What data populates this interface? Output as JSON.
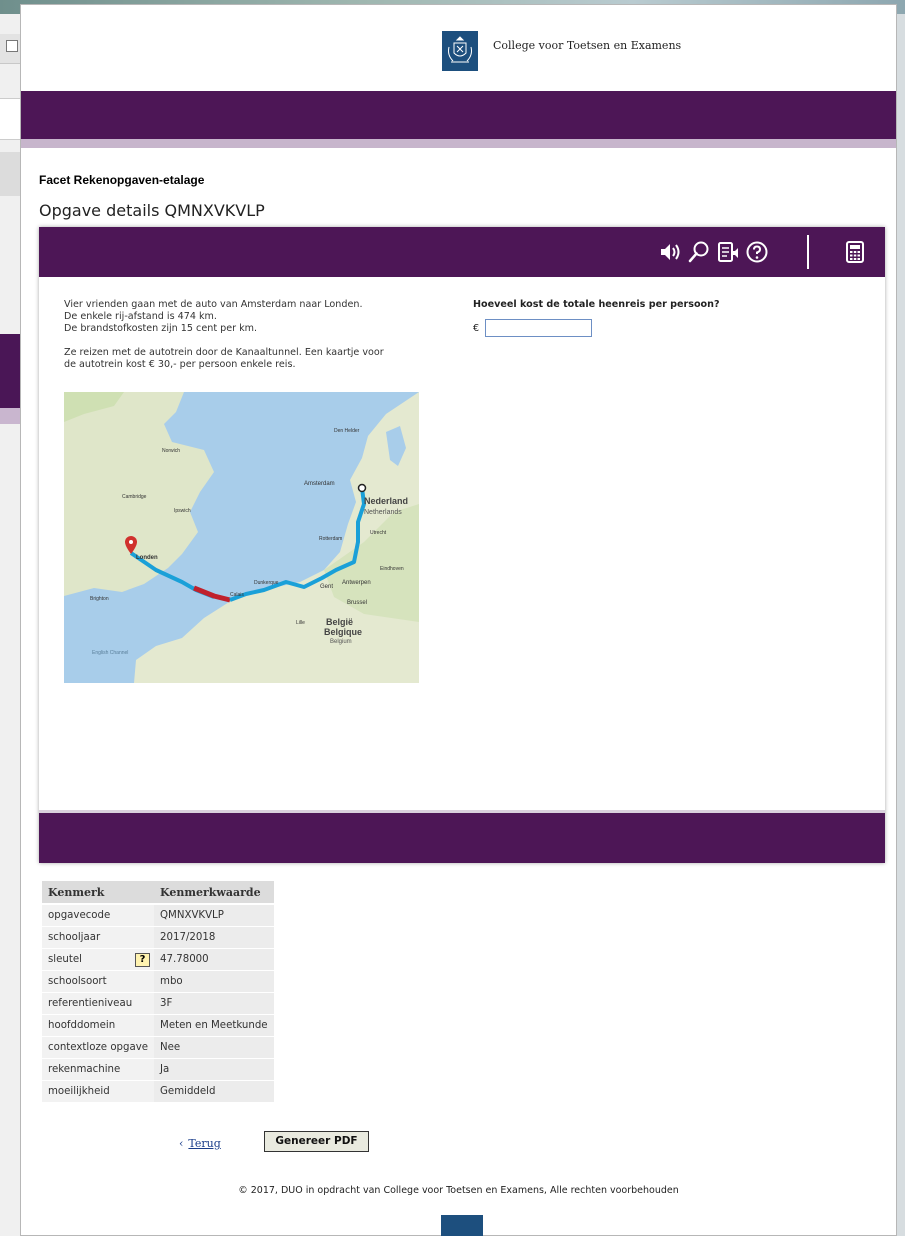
{
  "header": {
    "organization": "College voor Toetsen en Examens",
    "logo_icon": "rijkswapen-crest-icon"
  },
  "page": {
    "section": "Facet Rekenopgaven-etalage",
    "title": "Opgave details QMNXVKVLP"
  },
  "toolbar": {
    "icons": [
      "speaker-icon",
      "magnifier-icon",
      "read-aloud-icon",
      "help-icon",
      "calculator-icon"
    ]
  },
  "question": {
    "lines": [
      "Vier vrienden gaan met de auto van Amsterdam naar Londen.",
      "De enkele rij-afstand is 474 km.",
      "De brandstofkosten zijn 15 cent per km.",
      "Ze reizen met de autotrein door de Kanaaltunnel. Een kaartje voor",
      "de autotrein kost € 30,- per persoon enkele reis."
    ],
    "prompt": "Hoeveel kost de totale heenreis per persoon?",
    "currency": "€",
    "answer_value": ""
  },
  "map": {
    "labels": {
      "amsterdam": "Amsterdam",
      "londen": "Londen",
      "nederland": "Nederland",
      "netherlands": "Netherlands",
      "belgie": "België",
      "belgique": "Belgique",
      "belgium": "Belgium",
      "english_channel": "English Channel",
      "rotterdam": "Rotterdam",
      "antwerpen": "Antwerpen",
      "gent": "Gent",
      "brussel": "Brussel",
      "norwich": "Norwich",
      "cambridge": "Cambridge",
      "ipswich": "Ipswich",
      "brighton": "Brighton",
      "den_helder": "Den Helder",
      "utrecht": "Utrecht",
      "eindhoven": "Eindhoven",
      "lille": "Lille",
      "calais": "Calais",
      "dunkerque": "Dunkerque"
    }
  },
  "properties": {
    "headers": [
      "Kenmerk",
      "Kenmerkwaarde"
    ],
    "rows": [
      {
        "key": "opgavecode",
        "value": "QMNXVKVLP"
      },
      {
        "key": "schooljaar",
        "value": "2017/2018"
      },
      {
        "key": "sleutel",
        "value": "47.78000",
        "help": "?"
      },
      {
        "key": "schoolsoort",
        "value": "mbo"
      },
      {
        "key": "referentieniveau",
        "value": "3F"
      },
      {
        "key": "hoofddomein",
        "value": "Meten en Meetkunde"
      },
      {
        "key": "contextloze opgave",
        "value": "Nee"
      },
      {
        "key": "rekenmachine",
        "value": "Ja"
      },
      {
        "key": "moeilijkheid",
        "value": "Gemiddeld"
      }
    ]
  },
  "actions": {
    "back_arrow": "‹",
    "back_label": "Terug",
    "pdf_label": "Genereer PDF"
  },
  "footer": {
    "copyright": "© 2017, DUO in opdracht van College voor Toetsen en Examens, Alle rechten voorbehouden"
  },
  "colors": {
    "brand_purple": "#4d1656",
    "lilac": "#c7b5cc",
    "crest_blue": "#1d4f7e",
    "link_blue": "#1a3d8a"
  }
}
